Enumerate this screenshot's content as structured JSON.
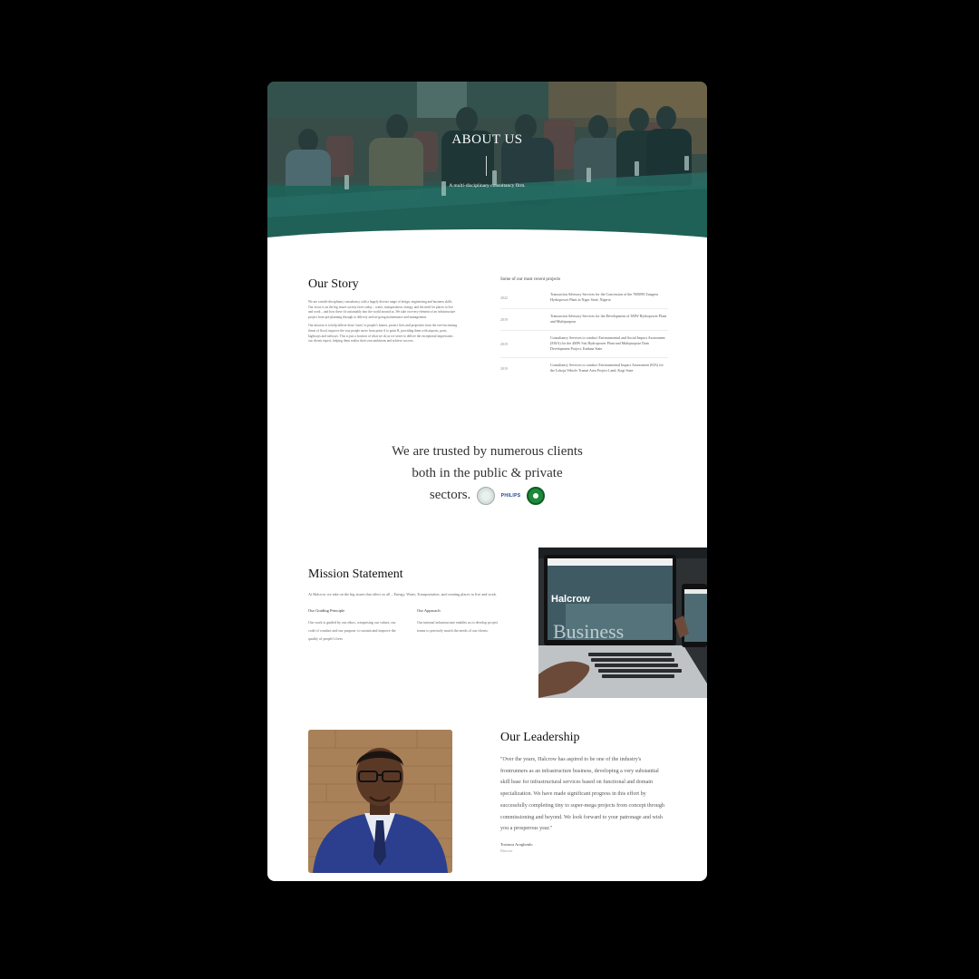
{
  "hero": {
    "title": "ABOUT US",
    "tagline": "A multi-disciplinary consultancy firm."
  },
  "story": {
    "heading_plain": "Our ",
    "heading_highlight": "Story",
    "paragraphs": [
      "We are a multi-disciplinary consultancy with a hugely diverse range of design, engineering and business skills. Our focus is on the big issues society faces today – water, transportation, energy, and the need for places to live and work – and how these fit sustainably into the world around us. We take on every element of an infrastructure project from pre-planning through to delivery and on-going maintenance and management.",
      "Our mission is to help deliver these 'eases' to people's homes, protect lives and properties from the ever-increasing threat of flood, improve the way people move from point A to point B, providing them with airports, ports, highways and railways. This is just a fraction of what we do as we strive to deliver the exceptional impressions our clients expect, helping them realise their own ambitions and achieve success."
    ]
  },
  "projects": {
    "heading": "Some of our most recent projects",
    "items": [
      {
        "year": "2022",
        "desc": "Transaction Advisory Services for the Concession of the 700MW Zungeru Hydropower Plant in Niger State, Nigeria"
      },
      {
        "year": "2019",
        "desc": "Transaction Advisory Services for the Development of 3MW Hydropower Plant and Multipurpose"
      },
      {
        "year": "2019",
        "desc": "Consultancy Services to conduct Environmental and Social Impact Assessment (ESIA) for the 4MW Sisi Hydropower Plant and Multipurpose Dam Development Project, Kaduna State"
      },
      {
        "year": "2019",
        "desc": "Consultancy Services to conduct Environmental Impact Assessment (EIA) for the Lokoja Vehicle Transit Area Project Land, Kogi State"
      }
    ]
  },
  "trusted": {
    "line1": "We are trusted by numerous clients",
    "line2": "both in the public &  private",
    "line3": "sectors.",
    "logo_text": "PHILIPS"
  },
  "mission": {
    "heading_plain": "Mission ",
    "heading_highlight": "Statement",
    "lead": "At Halcrow we take on the big issues that affect us all – Energy, Water, Transportation, and creating places to live and work.",
    "principle_title": "Our Guiding Principle",
    "principle_body": "Our work is guided by our ethos, comprising our values, our code of conduct and our purpose: to sustain and improve the quality of people's lives",
    "approach_title": "Our Approach",
    "approach_body": "Our internal infrastructure enables us to develop project teams to precisely match the needs of our clients.",
    "screen_brand": "Halcrow",
    "screen_word": "Business"
  },
  "leadership": {
    "heading_plain": "Our ",
    "heading_highlight": "Leadership",
    "quote": "\"Over the years, Halcrow has aspired to be one of the industry's frontrunners as an infrastructure business, developing a very substantial skill base for infrastructural services based on functional and domain specialization. We have made significant progress in this effort by successfully completing tiny to super-mega projects from concept through commissioning and beyond. We look forward to your patronage and wish you a prosperous year.\"",
    "name": "Tosinwa Arogbonlo",
    "role": "Director"
  },
  "colors": {
    "hero_teal": "#1b6b62",
    "highlight_green": "#0e6b57",
    "highlight_yellow": "#d8d23a"
  }
}
